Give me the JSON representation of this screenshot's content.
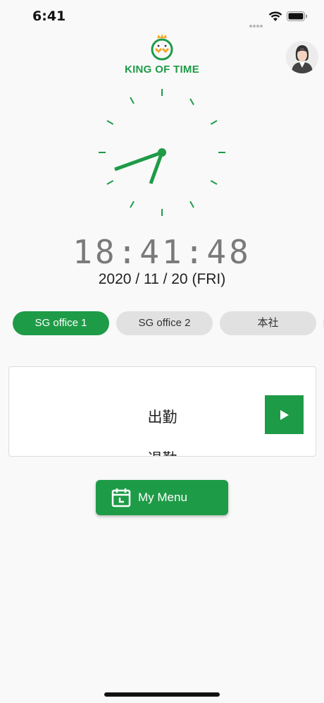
{
  "status_bar": {
    "time": "6:41"
  },
  "header": {
    "logo_text": "KING OF TIME"
  },
  "clock": {
    "digital_time": "18:41:48",
    "date": "2020 / 11 / 20 (FRI)"
  },
  "offices": [
    {
      "label": "SG office 1",
      "active": true
    },
    {
      "label": "SG office 2",
      "active": false
    },
    {
      "label": "本社",
      "active": false
    }
  ],
  "punch": {
    "items": [
      "出勤",
      "退勤"
    ],
    "button_icon": "play-icon"
  },
  "my_menu": {
    "label": "My Menu",
    "icon": "calendar-clock-icon"
  },
  "colors": {
    "accent": "#1e9b47",
    "tab_inactive": "#e1e1e1",
    "background": "#f9f9f9"
  }
}
